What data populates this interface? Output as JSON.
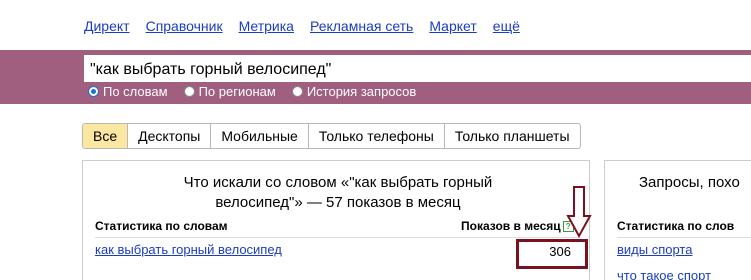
{
  "nav": {
    "items": [
      {
        "label": "Директ"
      },
      {
        "label": "Справочник"
      },
      {
        "label": "Метрика"
      },
      {
        "label": "Рекламная сеть"
      },
      {
        "label": "Маркет"
      },
      {
        "label": "ещё"
      }
    ]
  },
  "search": {
    "value": "\"как выбрать горный велосипед\"",
    "radios": [
      {
        "label": "По словам",
        "selected": true
      },
      {
        "label": "По регионам",
        "selected": false
      },
      {
        "label": "История запросов",
        "selected": false
      }
    ]
  },
  "tabs": [
    {
      "label": "Все",
      "active": true
    },
    {
      "label": "Десктопы",
      "active": false
    },
    {
      "label": "Мобильные",
      "active": false
    },
    {
      "label": "Только телефоны",
      "active": false
    },
    {
      "label": "Только планшеты",
      "active": false
    }
  ],
  "left_panel": {
    "title_line1": "Что искали со словом «\"как выбрать горный",
    "title_line2": "велосипед\"» — 57 показов в месяц",
    "col_words": "Статистика по словам",
    "col_impressions": "Показов в месяц",
    "help_glyph": "?",
    "rows": [
      {
        "phrase": "как выбрать горный велосипед",
        "count": "306"
      }
    ]
  },
  "right_panel": {
    "title": "Запросы, похо",
    "col_words": "Статистика по слов",
    "rows": [
      {
        "phrase": "виды спорта"
      },
      {
        "phrase": "что такое спорт"
      }
    ]
  },
  "colors": {
    "search_band": "#a15f80",
    "active_tab": "#fbe7a2",
    "link": "#1a3dc1",
    "highlight_annotation": "#7b1020"
  },
  "icons": {
    "annotation_arrow": "down-arrow-icon",
    "help": "help-icon"
  }
}
